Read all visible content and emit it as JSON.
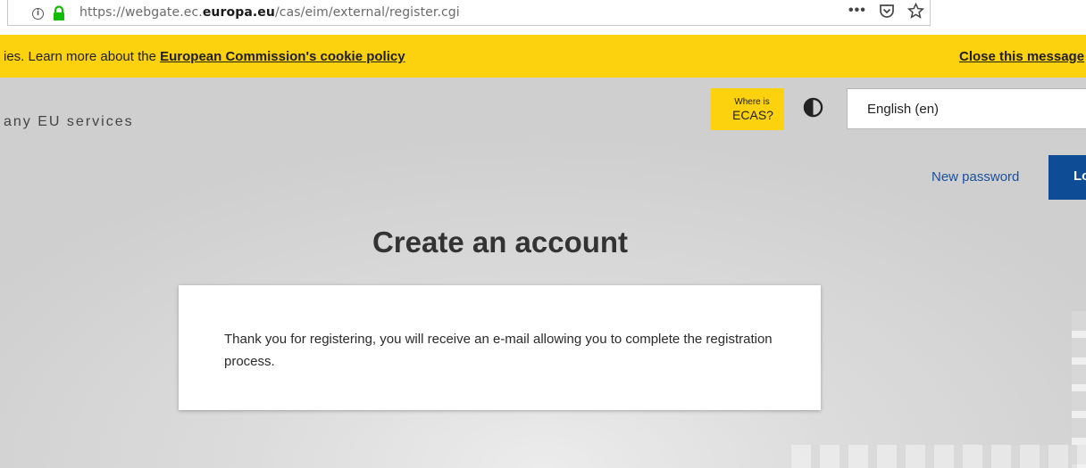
{
  "browser": {
    "url_prefix": "https://webgate.ec.",
    "url_domain": "europa.eu",
    "url_path": "/cas/eim/external/register.cgi",
    "actions": [
      "more-icon",
      "pocket-icon",
      "bookmark-star-icon"
    ]
  },
  "cookie_banner": {
    "text": "ies. Learn more about the ",
    "link_label": "European Commission's cookie policy",
    "close_label": "Close this message"
  },
  "header": {
    "tagline": "any EU services",
    "where_is_line1": "Where is",
    "where_is_line2": "ECAS?",
    "language": "English (en)"
  },
  "nav": {
    "new_password": "New password",
    "login": "Login"
  },
  "main": {
    "title": "Create an account",
    "message": "Thank you for registering, you will receive an e-mail allowing you to complete the registration process."
  },
  "colors": {
    "banner": "#fcd20f",
    "primary": "#0e4c96",
    "link": "#1b4f9e"
  }
}
